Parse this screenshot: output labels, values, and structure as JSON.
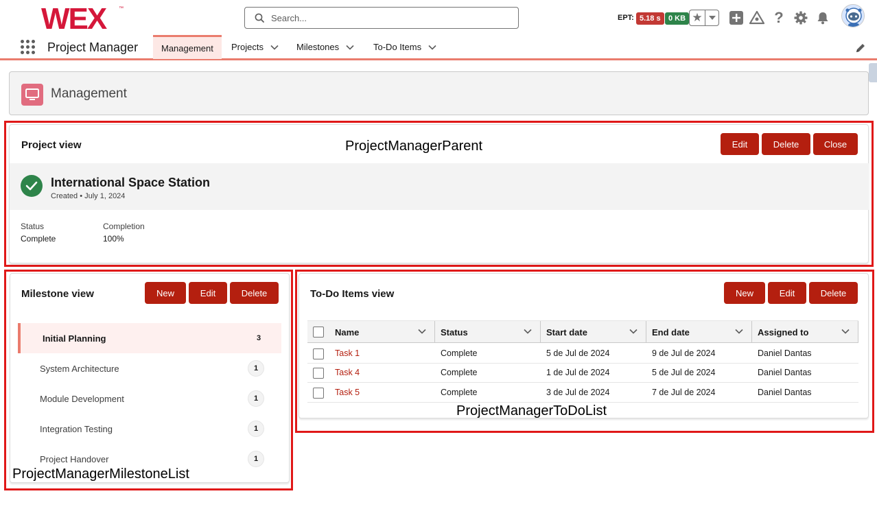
{
  "header": {
    "logo_text": "WEX",
    "search_placeholder": "Search...",
    "ept_label": "EPT:",
    "ept_time": "5.18 s",
    "ept_size": "0 KB",
    "brand_color": "#d5173a"
  },
  "nav": {
    "app_name": "Project Manager",
    "tabs": [
      {
        "label": "Management",
        "active": true
      },
      {
        "label": "Projects"
      },
      {
        "label": "Milestones"
      },
      {
        "label": "To-Do Items"
      }
    ]
  },
  "page": {
    "title": "Management"
  },
  "annotations": {
    "parent": "ProjectManagerParent",
    "milestones": "ProjectManagerMilestoneList",
    "todos": "ProjectManagerToDoList"
  },
  "project_view": {
    "title": "Project view",
    "buttons": {
      "edit": "Edit",
      "delete": "Delete",
      "close": "Close"
    },
    "project_name": "International Space Station",
    "created": "Created • July 1, 2024",
    "status_label": "Status",
    "status_value": "Complete",
    "completion_label": "Completion",
    "completion_value": "100%"
  },
  "milestone_view": {
    "title": "Milestone view",
    "buttons": {
      "new": "New",
      "edit": "Edit",
      "delete": "Delete"
    },
    "items": [
      {
        "name": "Initial Planning",
        "count": "3",
        "selected": true
      },
      {
        "name": "System Architecture",
        "count": "1"
      },
      {
        "name": "Module Development",
        "count": "1"
      },
      {
        "name": "Integration Testing",
        "count": "1"
      },
      {
        "name": "Project Handover",
        "count": "1"
      }
    ]
  },
  "todo_view": {
    "title": "To-Do Items view",
    "buttons": {
      "new": "New",
      "edit": "Edit",
      "delete": "Delete"
    },
    "columns": [
      "Name",
      "Status",
      "Start date",
      "End date",
      "Assigned to"
    ],
    "rows": [
      {
        "name": "Task 1",
        "status": "Complete",
        "start": "5 de Jul de 2024",
        "end": "9 de Jul de 2024",
        "assigned": "Daniel Dantas"
      },
      {
        "name": "Task 4",
        "status": "Complete",
        "start": "1 de Jul de 2024",
        "end": "5 de Jul de 2024",
        "assigned": "Daniel Dantas"
      },
      {
        "name": "Task 5",
        "status": "Complete",
        "start": "3 de Jul de 2024",
        "end": "7 de Jul de 2024",
        "assigned": "Daniel Dantas"
      }
    ]
  }
}
